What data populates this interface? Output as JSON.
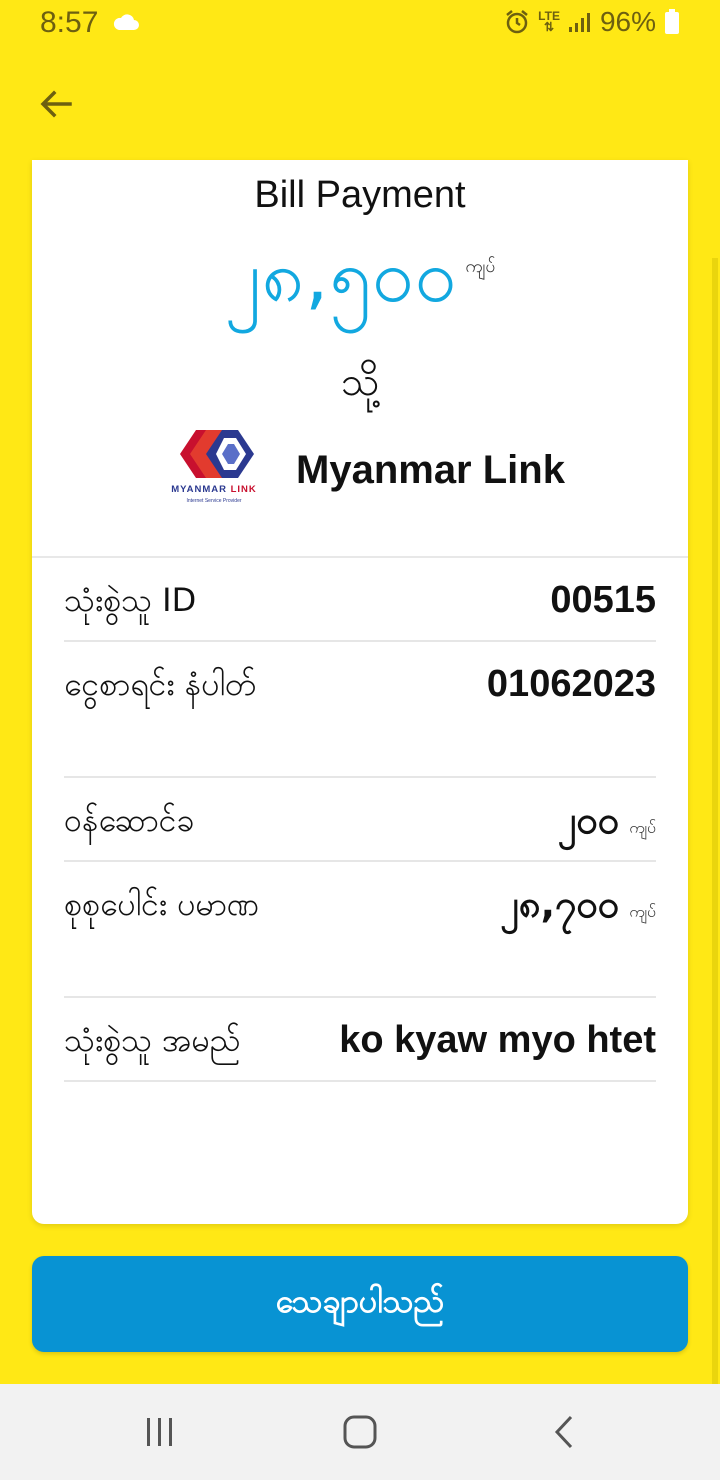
{
  "status_bar": {
    "time": "8:57",
    "battery": "96%",
    "network": "LTE",
    "icons": [
      "cloud-icon",
      "alarm-icon",
      "lte-icon",
      "signal-icon",
      "battery-icon"
    ]
  },
  "header": {
    "back_icon": "arrow-left-icon"
  },
  "card": {
    "title": "Bill Payment",
    "amount": "၂၈,၅၀၀",
    "currency": "ကျပ်",
    "to_label": "သို့",
    "merchant": {
      "name": "Myanmar Link",
      "logo_text": "MYANMAR LINK",
      "logo_subtext": "Internet Service Provider"
    },
    "details": [
      {
        "label": "သုံးစွဲသူ ID",
        "value": "00515",
        "unit": ""
      },
      {
        "label": "ငွေစာရင်း နံပါတ်",
        "value": "01062023",
        "unit": ""
      },
      {
        "label": "ဝန်ဆောင်ခ",
        "value": "၂၀၀",
        "unit": "ကျပ်"
      },
      {
        "label": "စုစုပေါင်း ပမာဏ",
        "value": "၂၈,၇၀၀",
        "unit": "ကျပ်"
      },
      {
        "label": "သုံးစွဲသူ အမည်",
        "value": "ko kyaw myo htet",
        "unit": ""
      }
    ]
  },
  "confirm_button": {
    "label": "သေချာပါသည်"
  },
  "colors": {
    "background": "#FFE815",
    "amount": "#12A8E0",
    "button": "#0893D3"
  }
}
